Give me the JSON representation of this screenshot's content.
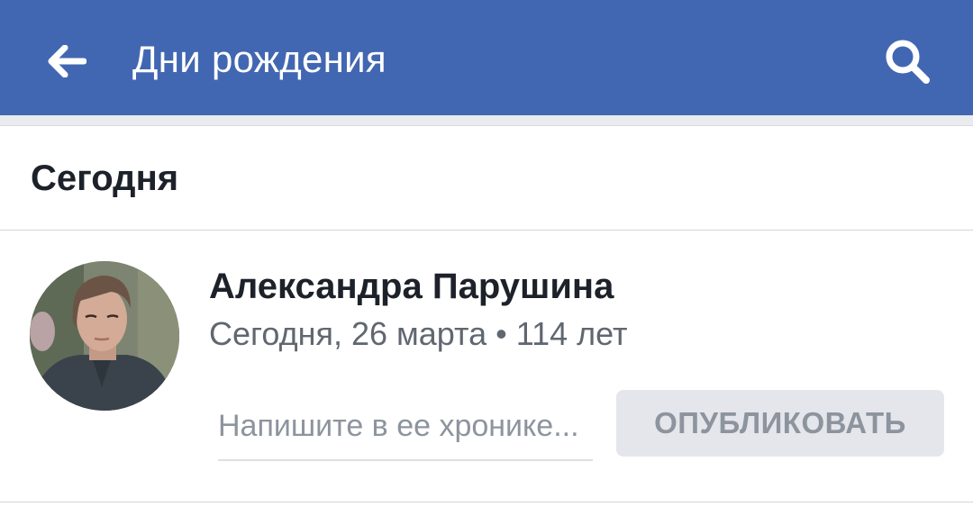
{
  "header": {
    "title": "Дни рождения",
    "back_icon": "arrow-left-icon",
    "search_icon": "search-icon",
    "background": "#4267B2"
  },
  "section": {
    "title": "Сегодня"
  },
  "person": {
    "name": "Александра Парушина",
    "meta": "Сегодня, 26 марта • 114 лет",
    "post_placeholder": "Напишите в ее хронике...",
    "publish_label": "ОПУБЛИКОВАТЬ"
  }
}
